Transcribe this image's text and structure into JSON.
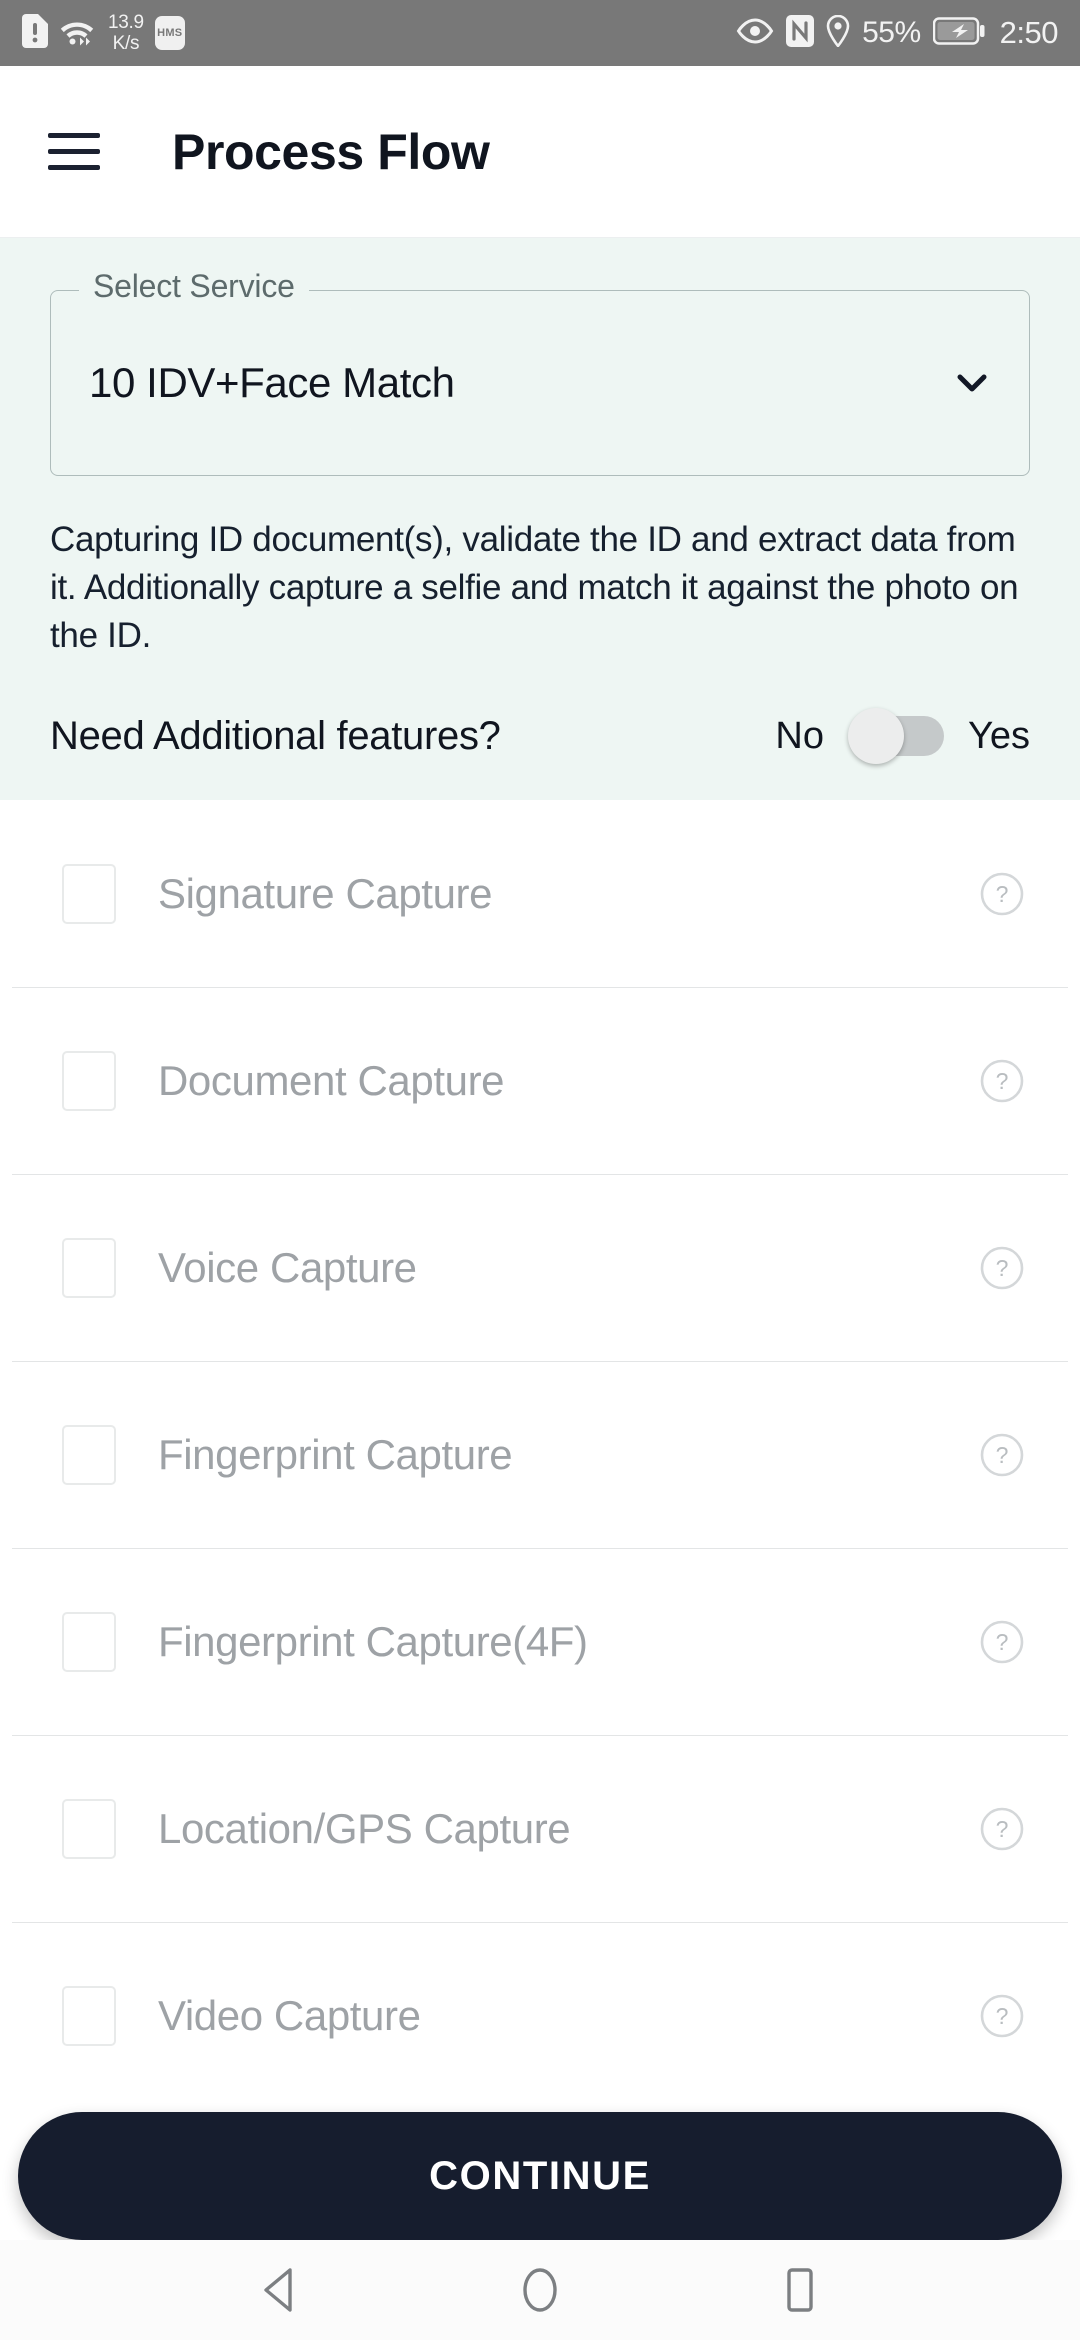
{
  "status_bar": {
    "sim_icon": "sim-alert-icon",
    "wifi_icon": "wifi-icon",
    "network_speed_value": "13.9",
    "network_speed_unit": "K/s",
    "hms_badge": "HMS",
    "eye_icon": "eye-icon",
    "nfc_icon": "nfc-icon",
    "location_icon": "location-pin-icon",
    "battery_percent": "55%",
    "battery_icon": "battery-charging-icon",
    "time": "2:50",
    "background_color": "#787878"
  },
  "app_bar": {
    "menu_icon": "hamburger-menu-icon",
    "title": "Process Flow"
  },
  "service_panel": {
    "background_color": "#eef6f3",
    "field_label": "Select Service",
    "selected_service": "10 IDV+Face Match",
    "dropdown_icon": "chevron-down-icon",
    "description": "Capturing ID document(s), validate the ID and extract data from it. Additionally capture a selfie and match it against the photo on the ID.",
    "toggle": {
      "question": "Need Additional features?",
      "off_label": "No",
      "on_label": "Yes",
      "state": "off"
    }
  },
  "features": {
    "help_icon": "help-circle-icon",
    "items": [
      {
        "label": "Signature Capture",
        "checked": false
      },
      {
        "label": "Document Capture",
        "checked": false
      },
      {
        "label": "Voice Capture",
        "checked": false
      },
      {
        "label": "Fingerprint Capture",
        "checked": false
      },
      {
        "label": "Fingerprint Capture(4F)",
        "checked": false
      },
      {
        "label": "Location/GPS Capture",
        "checked": false
      },
      {
        "label": "Video Capture",
        "checked": false
      }
    ]
  },
  "cta": {
    "label": "CONTINUE",
    "background_color": "#161d2e"
  },
  "nav_bar": {
    "back_icon": "back-triangle-icon",
    "home_icon": "home-circle-icon",
    "recents_icon": "recents-square-icon"
  }
}
